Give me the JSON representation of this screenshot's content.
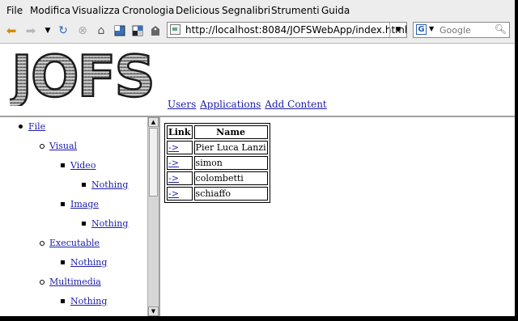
{
  "browser": {
    "menu": [
      "File",
      "Modifica",
      "Visualizza",
      "Cronologia",
      "Delicious",
      "Segnalibri",
      "Strumenti",
      "Guida"
    ],
    "toolbar_icons": [
      "back-icon",
      "forward-icon",
      "history-dropdown-icon",
      "reload-icon",
      "stop-icon",
      "home-icon",
      "bookmark-icon",
      "delicious-icon",
      "tag-icon"
    ],
    "url": "http://localhost:8084/JOFSWebApp/index.html",
    "search": {
      "engine": "G",
      "placeholder": "Google"
    }
  },
  "page": {
    "logo_text": "JOFS",
    "nav": [
      "Users",
      "Applications",
      "Add Content"
    ],
    "tree": {
      "root": "File",
      "visual": "Visual",
      "video": "Video",
      "video_leaf": "Nothing",
      "image": "Image",
      "image_leaf": "Nothing",
      "executable": "Executable",
      "executable_leaf": "Nothing",
      "multimedia": "Multimedia",
      "multimedia_leaf": "Nothing"
    },
    "table": {
      "headers": [
        "Link",
        "Name"
      ],
      "rows": [
        {
          "link": "->",
          "name": "Pier Luca Lanzi"
        },
        {
          "link": "->",
          "name": "simon"
        },
        {
          "link": "->",
          "name": "colombetti"
        },
        {
          "link": "->",
          "name": "schiaffo"
        }
      ]
    }
  }
}
